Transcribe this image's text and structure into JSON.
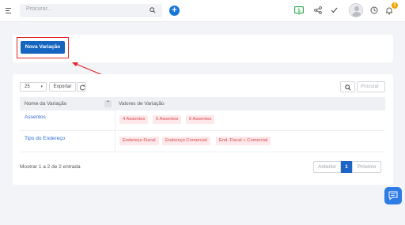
{
  "topbar": {
    "search_placeholder": "Procurar...",
    "notification_count": "1",
    "icons": [
      "menu-icon",
      "search-icon",
      "plus-icon",
      "dollar-icon",
      "share-icon",
      "check-icon",
      "avatar",
      "clock-icon",
      "bell-icon"
    ],
    "accent_color": "#1877d6",
    "status_green": "#27a745"
  },
  "actions": {
    "new_variation_label": "Nova Variação"
  },
  "table_controls": {
    "page_size": "25",
    "export_label": "Exportar",
    "search_placeholder": "Procurar"
  },
  "table": {
    "columns": [
      "Nome da Variação",
      "Valores de Variação"
    ],
    "rows": [
      {
        "name": "Assentos",
        "values": [
          "4 Assentos",
          "5 Assentos",
          "6 Assentos"
        ]
      },
      {
        "name": "Tipo do Endereço",
        "values": [
          "Endereço Fiscal",
          "Endereço Comercial",
          "End. Fiscal + Comercial"
        ]
      }
    ]
  },
  "footer": {
    "info": "Mostrar 1 a 2 de 2 entrada",
    "prev_label": "Anterior",
    "current_page": "1",
    "next_label": "Próximo"
  },
  "colors": {
    "primary": "#1565c0",
    "chip_bg": "#fde9ea",
    "chip_text": "#d9434c",
    "link": "#2f6dd3",
    "highlight": "#e0262b"
  }
}
